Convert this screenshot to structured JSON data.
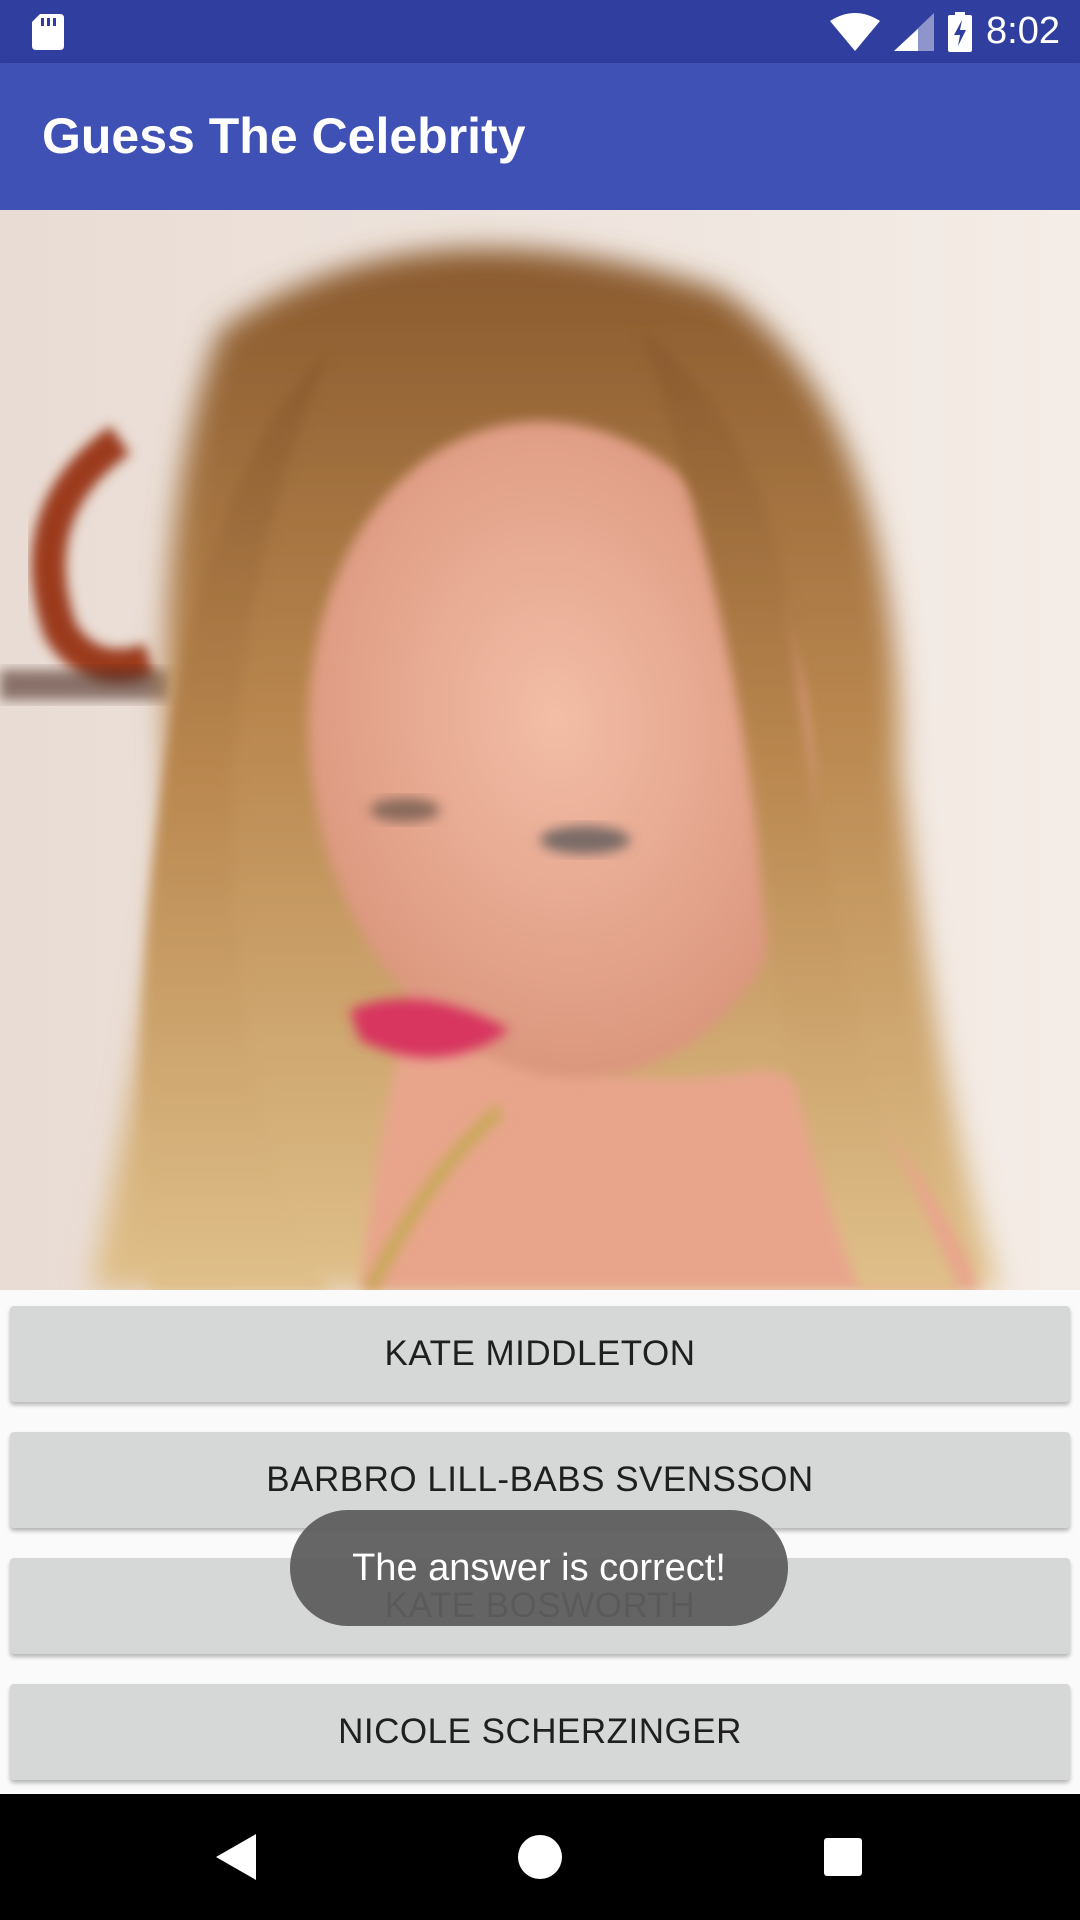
{
  "status_bar": {
    "time": "8:02",
    "icons": [
      "sd-card-icon",
      "wifi-icon",
      "signal-icon",
      "battery-charging-icon"
    ]
  },
  "app_bar": {
    "title": "Guess The Celebrity"
  },
  "answers": [
    {
      "label": "KATE MIDDLETON"
    },
    {
      "label": "BARBRO LILL-BABS SVENSSON"
    },
    {
      "label": "KATE BOSWORTH"
    },
    {
      "label": "NICOLE SCHERZINGER"
    }
  ],
  "toast": {
    "message": "The answer is correct!"
  },
  "nav_bar": {
    "icons": [
      "back-icon",
      "home-icon",
      "recents-icon"
    ]
  },
  "colors": {
    "status_bar": "#303f9f",
    "app_bar": "#3f51b5",
    "button": "#d6d7d7",
    "toast": "#5e5e5e"
  }
}
